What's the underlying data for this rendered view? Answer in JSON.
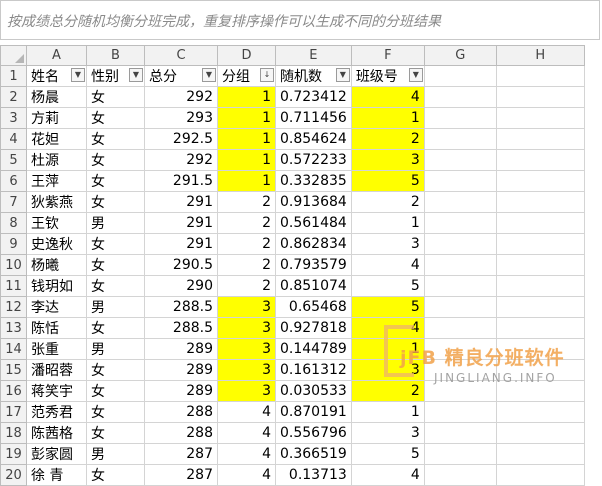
{
  "formula_bar": {
    "text": "按成绩总分随机均衡分班完成，重复排序操作可以生成不同的分班结果"
  },
  "columns": [
    "A",
    "B",
    "C",
    "D",
    "E",
    "F",
    "G",
    "H"
  ],
  "headers": {
    "name": "姓名",
    "gender": "性别",
    "total": "总分",
    "group": "分组",
    "random": "随机数",
    "class": "班级号"
  },
  "rows": [
    {
      "n": "2",
      "name": "杨晨",
      "gender": "女",
      "total": "292",
      "group": "1",
      "random": "0.723412",
      "class": "4"
    },
    {
      "n": "3",
      "name": "方莉",
      "gender": "女",
      "total": "293",
      "group": "1",
      "random": "0.711456",
      "class": "1"
    },
    {
      "n": "4",
      "name": "花妲",
      "gender": "女",
      "total": "292.5",
      "group": "1",
      "random": "0.854624",
      "class": "2"
    },
    {
      "n": "5",
      "name": "杜源",
      "gender": "女",
      "total": "292",
      "group": "1",
      "random": "0.572233",
      "class": "3"
    },
    {
      "n": "6",
      "name": "王萍",
      "gender": "女",
      "total": "291.5",
      "group": "1",
      "random": "0.332835",
      "class": "5"
    },
    {
      "n": "7",
      "name": "狄紫燕",
      "gender": "女",
      "total": "291",
      "group": "2",
      "random": "0.913684",
      "class": "2"
    },
    {
      "n": "8",
      "name": "王钦",
      "gender": "男",
      "total": "291",
      "group": "2",
      "random": "0.561484",
      "class": "1"
    },
    {
      "n": "9",
      "name": "史逸秋",
      "gender": "女",
      "total": "291",
      "group": "2",
      "random": "0.862834",
      "class": "3"
    },
    {
      "n": "10",
      "name": "杨曦",
      "gender": "女",
      "total": "290.5",
      "group": "2",
      "random": "0.793579",
      "class": "4"
    },
    {
      "n": "11",
      "name": "钱玥如",
      "gender": "女",
      "total": "290",
      "group": "2",
      "random": "0.851074",
      "class": "5"
    },
    {
      "n": "12",
      "name": "李达",
      "gender": "男",
      "total": "288.5",
      "group": "3",
      "random": "0.65468",
      "class": "5"
    },
    {
      "n": "13",
      "name": "陈恬",
      "gender": "女",
      "total": "288.5",
      "group": "3",
      "random": "0.927818",
      "class": "4"
    },
    {
      "n": "14",
      "name": "张重",
      "gender": "男",
      "total": "289",
      "group": "3",
      "random": "0.144789",
      "class": "1"
    },
    {
      "n": "15",
      "name": "潘昭蓉",
      "gender": "女",
      "total": "289",
      "group": "3",
      "random": "0.161312",
      "class": "3"
    },
    {
      "n": "16",
      "name": "蒋笑宇",
      "gender": "女",
      "total": "289",
      "group": "3",
      "random": "0.030533",
      "class": "2"
    },
    {
      "n": "17",
      "name": "范秀君",
      "gender": "女",
      "total": "288",
      "group": "4",
      "random": "0.870191",
      "class": "1"
    },
    {
      "n": "18",
      "name": "陈茜格",
      "gender": "女",
      "total": "288",
      "group": "4",
      "random": "0.556796",
      "class": "3"
    },
    {
      "n": "19",
      "name": "彭家圆",
      "gender": "男",
      "total": "287",
      "group": "4",
      "random": "0.366519",
      "class": "5"
    },
    {
      "n": "20",
      "name": "徐 青",
      "gender": "女",
      "total": "287",
      "group": "4",
      "random": "0.13713",
      "class": "4"
    }
  ],
  "watermark": {
    "title": "jFB 精良分班软件",
    "url": "JINGLIANG.INFO"
  },
  "colors": {
    "highlight": "#ffff00",
    "watermark": "#f1a24a"
  },
  "icons": {
    "filter": "filter-dropdown-icon",
    "sort": "sort-filter-icon"
  }
}
